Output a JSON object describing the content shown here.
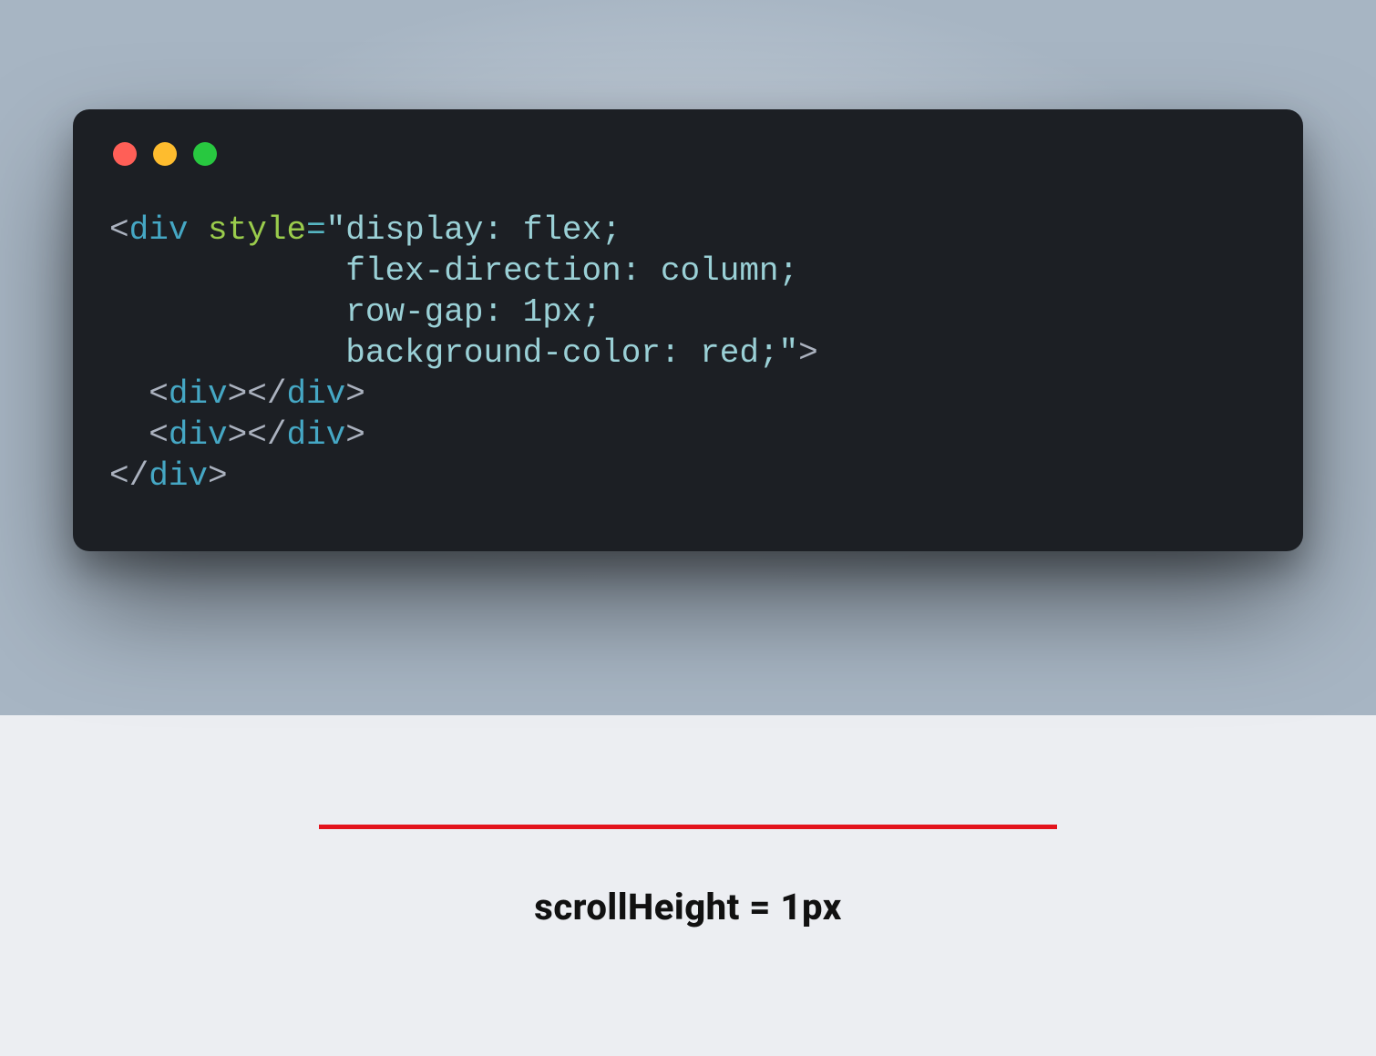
{
  "code": {
    "lines": [
      {
        "segments": [
          {
            "cls": "tok-punct",
            "text": "<"
          },
          {
            "cls": "tok-tag",
            "text": "div"
          },
          {
            "cls": "",
            "text": " "
          },
          {
            "cls": "tok-attr",
            "text": "style"
          },
          {
            "cls": "tok-eq",
            "text": "="
          },
          {
            "cls": "tok-string",
            "text": "\"display: flex;"
          }
        ]
      },
      {
        "segments": [
          {
            "cls": "tok-string",
            "text": "            flex-direction: column;"
          }
        ]
      },
      {
        "segments": [
          {
            "cls": "tok-string",
            "text": "            row-gap: 1px;"
          }
        ]
      },
      {
        "segments": [
          {
            "cls": "tok-string",
            "text": "            background-color: red;\""
          },
          {
            "cls": "tok-punct",
            "text": ">"
          }
        ]
      },
      {
        "segments": [
          {
            "cls": "",
            "text": "  "
          },
          {
            "cls": "tok-punct",
            "text": "<"
          },
          {
            "cls": "tok-tag",
            "text": "div"
          },
          {
            "cls": "tok-punct",
            "text": "></"
          },
          {
            "cls": "tok-tag",
            "text": "div"
          },
          {
            "cls": "tok-punct",
            "text": ">"
          }
        ]
      },
      {
        "segments": [
          {
            "cls": "",
            "text": "  "
          },
          {
            "cls": "tok-punct",
            "text": "<"
          },
          {
            "cls": "tok-tag",
            "text": "div"
          },
          {
            "cls": "tok-punct",
            "text": "></"
          },
          {
            "cls": "tok-tag",
            "text": "div"
          },
          {
            "cls": "tok-punct",
            "text": ">"
          }
        ]
      },
      {
        "segments": [
          {
            "cls": "tok-punct",
            "text": "</"
          },
          {
            "cls": "tok-tag",
            "text": "div"
          },
          {
            "cls": "tok-punct",
            "text": ">"
          }
        ]
      }
    ]
  },
  "caption": "scrollHeight = 1px",
  "colors": {
    "window_bg": "#1c1f24",
    "red_line": "#e3131c"
  }
}
